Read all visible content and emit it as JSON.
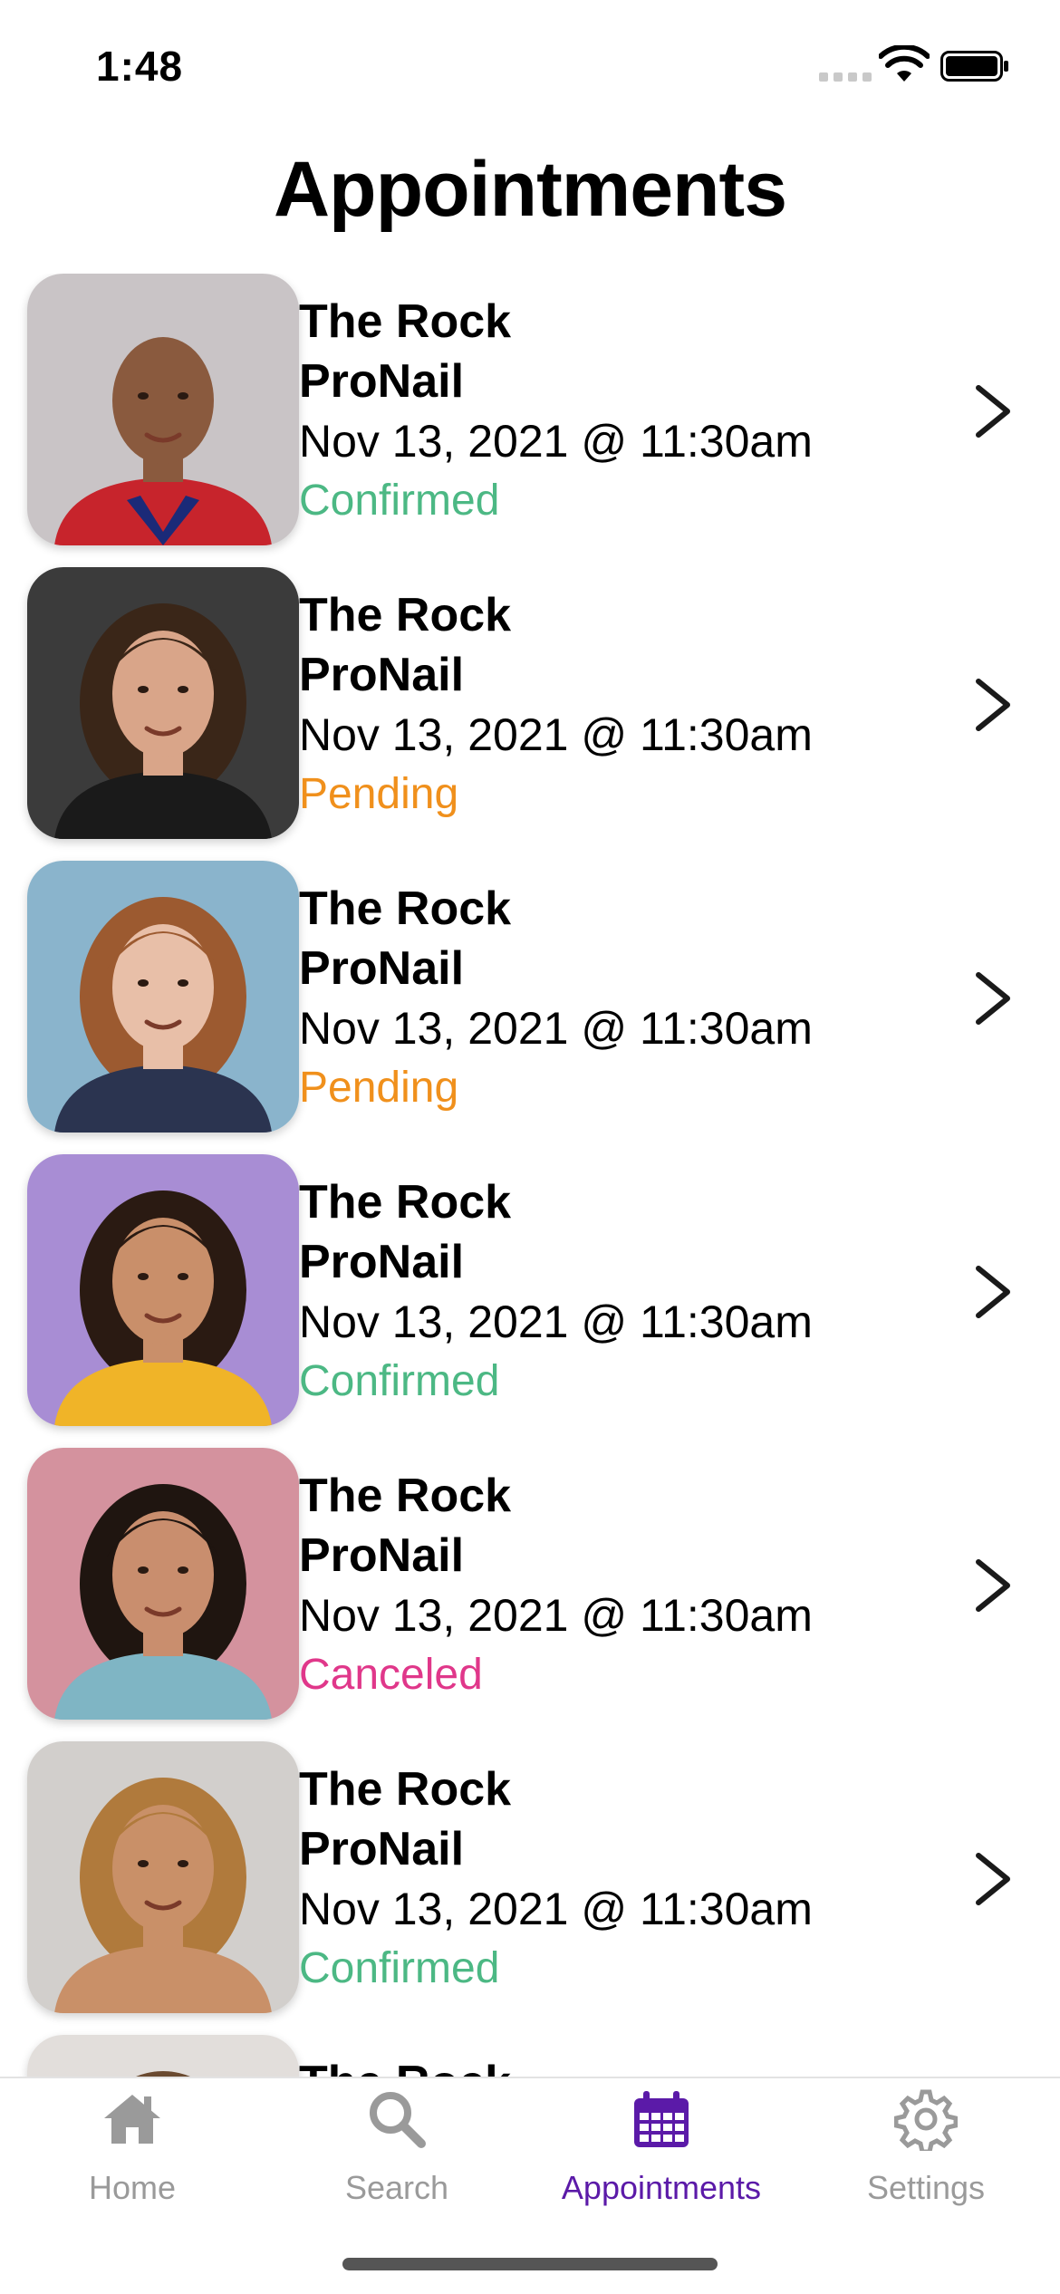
{
  "status_bar": {
    "time": "1:48"
  },
  "page": {
    "title": "Appointments"
  },
  "colors": {
    "confirmed": "#4cb884",
    "pending": "#f0901c",
    "canceled": "#e0378a",
    "tab_active": "#5b1aa8",
    "tab_inactive": "#9a9a9a"
  },
  "appointments": [
    {
      "name": "The Rock",
      "service": "ProNail",
      "datetime": "Nov 13, 2021 @ 11:30am",
      "status": "Confirmed",
      "avatar": "avatar-man-red-shirt"
    },
    {
      "name": "The Rock",
      "service": "ProNail",
      "datetime": "Nov 13, 2021 @ 11:30am",
      "status": "Pending",
      "avatar": "avatar-man-smiling"
    },
    {
      "name": "The Rock",
      "service": "ProNail",
      "datetime": "Nov 13, 2021 @ 11:30am",
      "status": "Pending",
      "avatar": "avatar-woman-redhead"
    },
    {
      "name": "The Rock",
      "service": "ProNail",
      "datetime": "Nov 13, 2021 @ 11:30am",
      "status": "Confirmed",
      "avatar": "avatar-woman-curly-hair"
    },
    {
      "name": "The Rock",
      "service": "ProNail",
      "datetime": "Nov 13, 2021 @ 11:30am",
      "status": "Canceled",
      "avatar": "avatar-woman-glasses"
    },
    {
      "name": "The Rock",
      "service": "ProNail",
      "datetime": "Nov 13, 2021 @ 11:30am",
      "status": "Confirmed",
      "avatar": "avatar-woman-portrait"
    },
    {
      "name": "The Rock",
      "service": "",
      "datetime": "",
      "status": "",
      "avatar": "avatar-partial"
    }
  ],
  "tabs": [
    {
      "label": "Home",
      "icon": "home-icon",
      "active": false
    },
    {
      "label": "Search",
      "icon": "search-icon",
      "active": false
    },
    {
      "label": "Appointments",
      "icon": "calendar-icon",
      "active": true
    },
    {
      "label": "Settings",
      "icon": "gear-icon",
      "active": false
    }
  ]
}
